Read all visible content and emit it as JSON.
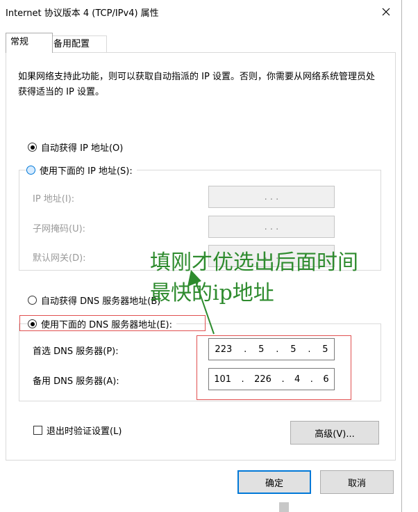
{
  "window": {
    "title": "Internet 协议版本 4 (TCP/IPv4) 属性",
    "close_icon": "close-icon"
  },
  "tabs": [
    {
      "label": "常规",
      "active": true
    },
    {
      "label": "备用配置",
      "active": false
    }
  ],
  "description": "如果网络支持此功能，则可以获取自动指派的 IP 设置。否则，你需要从网络系统管理员处获得适当的 IP 设置。",
  "ip_section": {
    "auto_label": "自动获得 IP 地址(O)",
    "manual_label": "使用下面的 IP 地址(S):",
    "selected": "auto",
    "fields": [
      {
        "label": "IP 地址(I):",
        "value": ".       .       ."
      },
      {
        "label": "子网掩码(U):",
        "value": ".       .       ."
      },
      {
        "label": "默认网关(D):",
        "value": ".       .       ."
      }
    ]
  },
  "dns_section": {
    "auto_label": "自动获得 DNS 服务器地址(B)",
    "manual_label": "使用下面的 DNS 服务器地址(E):",
    "selected": "manual",
    "preferred_label": "首选 DNS 服务器(P):",
    "preferred": [
      "223",
      "5",
      "5",
      "5"
    ],
    "alternate_label": "备用 DNS 服务器(A):",
    "alternate": [
      "101",
      "226",
      "4",
      "6"
    ]
  },
  "validate_label": "退出时验证设置(L)",
  "validate_checked": false,
  "advanced_label": "高级(V)...",
  "ok_label": "确定",
  "cancel_label": "取消",
  "annotation": {
    "line1": "填刚才优选出后面时间",
    "line2": "最快的ip地址",
    "color": "#2e8b2e"
  }
}
